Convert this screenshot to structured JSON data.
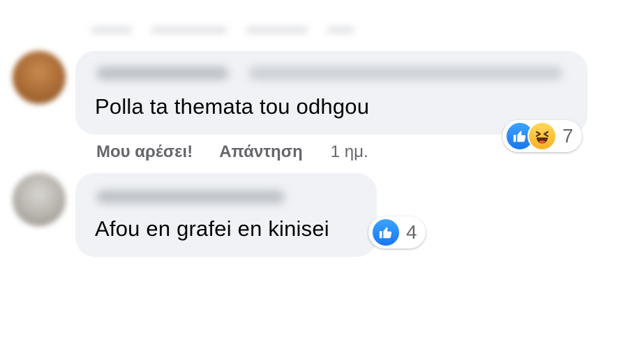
{
  "comments": [
    {
      "text": "Polla ta themata tou odhgou",
      "reaction_count": "7",
      "reactions": [
        "like",
        "haha"
      ],
      "actions": {
        "like_label": "Μου αρέσει!",
        "reply_label": "Απάντηση",
        "timestamp": "1 ημ."
      }
    },
    {
      "text": "Afou en grafei en kinisei",
      "reaction_count": "4",
      "reactions": [
        "like"
      ]
    }
  ],
  "icons": {
    "like": "like-reaction-icon",
    "haha": "haha-reaction-icon"
  },
  "colors": {
    "bubble": "#f0f2f5",
    "like_blue": "#1877f2",
    "haha_yellow": "#f7b125",
    "secondary_text": "#65676b"
  }
}
